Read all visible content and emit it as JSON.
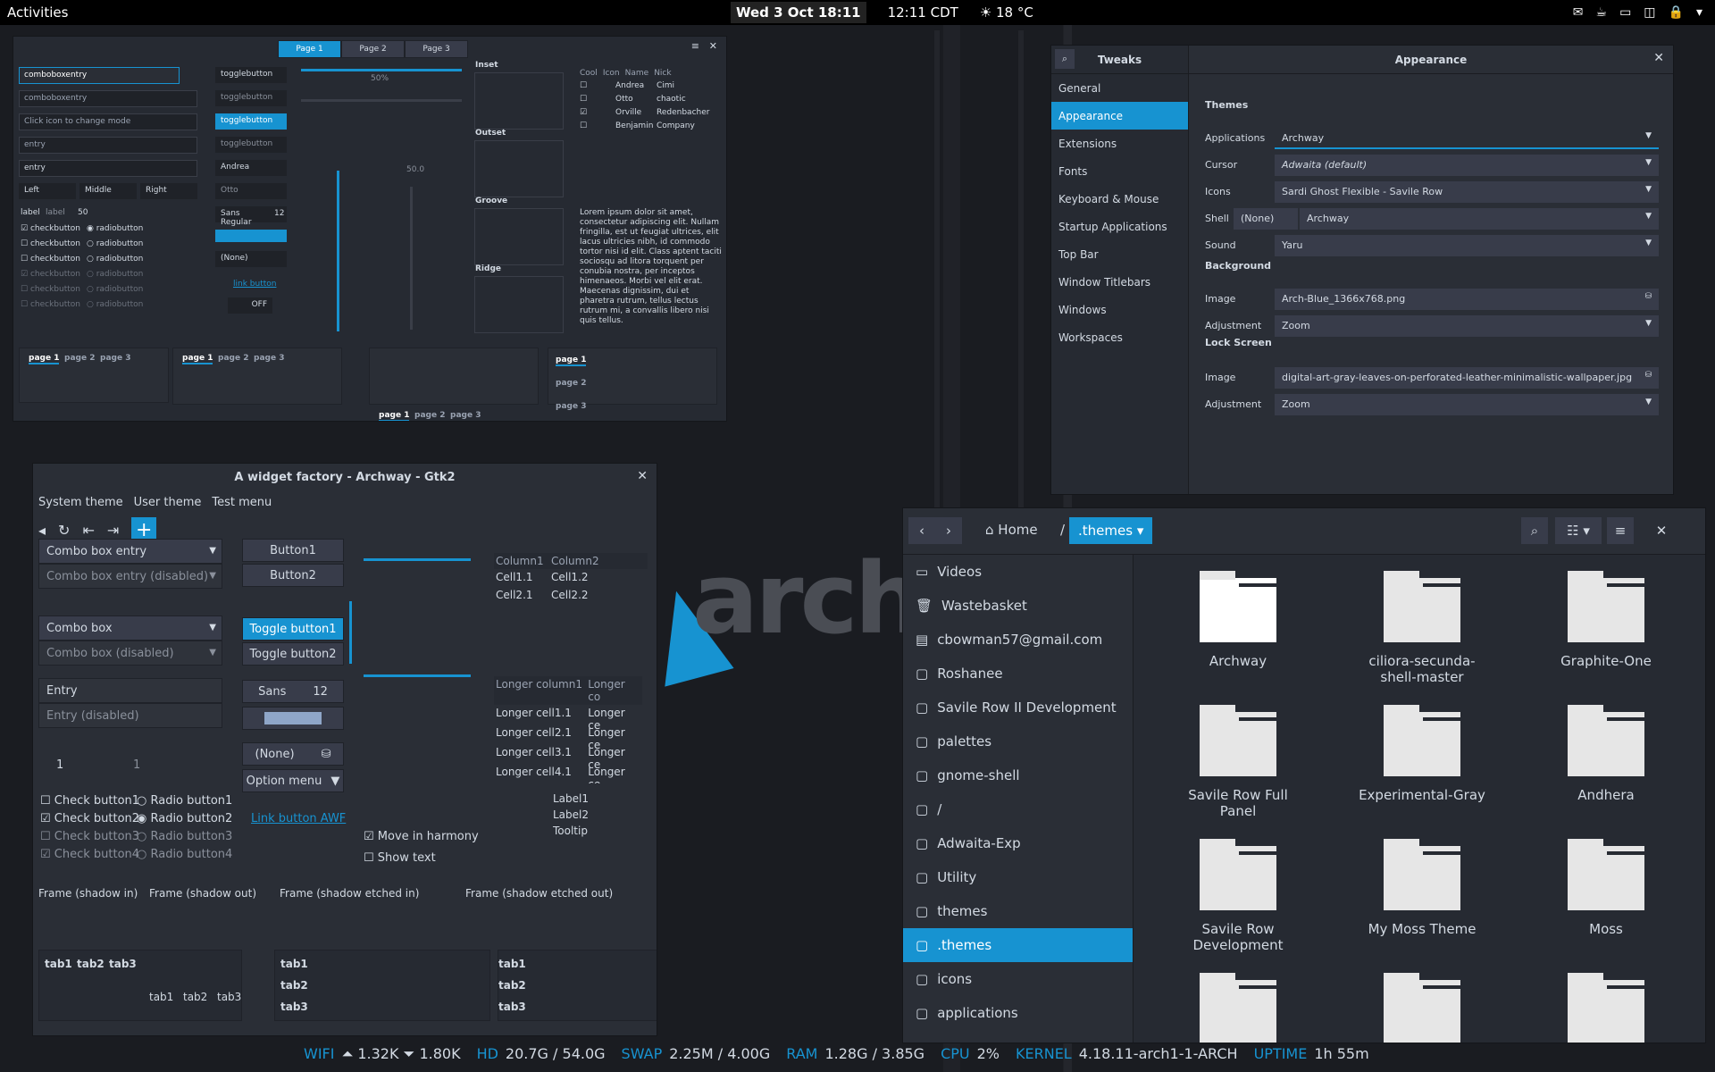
{
  "topbar": {
    "activities": "Activities",
    "clock": "Wed 3 Oct  18:11",
    "cdt": "12:11 CDT",
    "weather": "☀ 18 °C",
    "tray": [
      "✉",
      "☕",
      "▭",
      "◫",
      "🔒",
      "▾"
    ]
  },
  "statusbar": [
    {
      "k": "WIFI",
      "v": "⏶ 1.32K ⏷ 1.80K"
    },
    {
      "k": "HD",
      "v": "20.7G / 54.0G"
    },
    {
      "k": "SWAP",
      "v": "2.25M / 4.00G"
    },
    {
      "k": "RAM",
      "v": "1.28G / 3.85G"
    },
    {
      "k": "CPU",
      "v": "2%"
    },
    {
      "k": "KERNEL",
      "v": "4.18.11-arch1-1-ARCH"
    },
    {
      "k": "UPTIME",
      "v": "1h 55m"
    }
  ],
  "gtk3": {
    "tabs": [
      "Page 1",
      "Page 2",
      "Page 3"
    ],
    "inputs": [
      "comboboxentry",
      "comboboxentry",
      "Click icon to change mode",
      "entry",
      "entry"
    ],
    "align": [
      "Left",
      "Middle",
      "Right"
    ],
    "label": "label",
    "spin": "50",
    "checks": [
      "checkbutton",
      "checkbutton",
      "checkbutton",
      "checkbutton",
      "checkbutton",
      "checkbutton"
    ],
    "radios": [
      "radiobutton",
      "radiobutton",
      "radiobutton",
      "radiobutton",
      "radiobutton",
      "radiobutton"
    ],
    "toggles": [
      "togglebutton",
      "togglebutton",
      "togglebutton",
      "togglebutton"
    ],
    "combo1": "Andrea",
    "combo2": "Otto",
    "font": "Sans Regular",
    "fontsize": "12",
    "none": "(None)",
    "link": "link button",
    "off": "OFF",
    "scale1": "50%",
    "scale2": "50.0",
    "frames": [
      "Inset",
      "Outset",
      "Groove",
      "Ridge"
    ],
    "tree_headers": [
      "Cool",
      "Icon",
      "Name",
      "Nick"
    ],
    "tree": [
      [
        "Andrea",
        "Cimi"
      ],
      [
        "Otto",
        "chaotic"
      ],
      [
        "Orville",
        "Redenbacher"
      ],
      [
        "Benjamin",
        "Company"
      ]
    ],
    "lorem": "Lorem ipsum dolor sit amet, consectetur adipiscing elit. Nullam fringilla, est ut feugiat ultrices, elit lacus ultricies nibh, id commodo tortor nisi id elit. Class aptent taciti sociosqu ad litora torquent per conubia nostra, per inceptos himenaeos. Morbi vel elit erat. Maecenas dignissim, dui et pharetra rutrum, tellus lectus rutrum mi, a convallis libero nisi quis tellus.",
    "nb": [
      "page 1",
      "page 2",
      "page 3"
    ]
  },
  "tweaks": {
    "title": "Tweaks",
    "header": "Appearance",
    "sidebar": [
      "General",
      "Appearance",
      "Extensions",
      "Fonts",
      "Keyboard & Mouse",
      "Startup Applications",
      "Top Bar",
      "Window Titlebars",
      "Windows",
      "Workspaces"
    ],
    "themes": "Themes",
    "background": "Background",
    "lockscreen": "Lock Screen",
    "rows": {
      "applications": [
        "Applications",
        "Archway"
      ],
      "cursor": [
        "Cursor",
        "Adwaita (default)"
      ],
      "icons": [
        "Icons",
        "Sardi Ghost Flexible - Savile Row"
      ],
      "shell": [
        "Shell",
        "(None)",
        "Archway"
      ],
      "sound": [
        "Sound",
        "Yaru"
      ],
      "bgimage": [
        "Image",
        "Arch-Blue_1366x768.png"
      ],
      "bgadj": [
        "Adjustment",
        "Zoom"
      ],
      "lsimage": [
        "Image",
        "digital-art-gray-leaves-on-perforated-leather-minimalistic-wallpaper.jpg"
      ],
      "lsadj": [
        "Adjustment",
        "Zoom"
      ]
    }
  },
  "gtk2": {
    "title": "A widget factory - Archway - Gtk2",
    "menu": [
      "System theme",
      "User theme",
      "Test menu"
    ],
    "combos": [
      "Combo box entry",
      "Combo box entry (disabled)",
      "Combo box",
      "Combo box (disabled)"
    ],
    "entries": [
      "Entry",
      "Entry (disabled)"
    ],
    "spin": [
      "1",
      "1"
    ],
    "checks": [
      "Check button1",
      "Check button2",
      "Check button3",
      "Check button4"
    ],
    "radios": [
      "Radio button1",
      "Radio button2",
      "Radio button3",
      "Radio button4"
    ],
    "buttons": [
      "Button1",
      "Button2",
      "Toggle button1",
      "Toggle button2"
    ],
    "font": [
      "Sans",
      "12"
    ],
    "none": "(None)",
    "option": "Option menu",
    "link": "Link button AWF",
    "move": "Move in harmony",
    "show": "Show text",
    "tree1_headers": [
      "Column1",
      "Column2"
    ],
    "tree1": [
      [
        "Cell1.1",
        "Cell1.2"
      ],
      [
        "Cell2.1",
        "Cell2.2"
      ]
    ],
    "tree2_headers": [
      "Longer column1",
      "Longer co"
    ],
    "tree2": [
      [
        "Longer cell1.1",
        "Longer ce"
      ],
      [
        "Longer cell2.1",
        "Longer ce"
      ],
      [
        "Longer cell3.1",
        "Longer ce"
      ],
      [
        "Longer cell4.1",
        "Longer ce"
      ]
    ],
    "labels": [
      "Label1",
      "Label2",
      "Tooltip"
    ],
    "frames": [
      "Frame (shadow in)",
      "Frame (shadow out)",
      "Frame (shadow etched in)",
      "Frame (shadow etched out)"
    ],
    "tabs": [
      "tab1",
      "tab2",
      "tab3"
    ]
  },
  "files": {
    "path": [
      "Home",
      ".themes"
    ],
    "sidebar": [
      [
        "▭",
        "Videos"
      ],
      [
        "🗑",
        "Wastebasket"
      ],
      [
        "▤",
        "cbowman57@gmail.com"
      ],
      [
        "▢",
        "Roshanee"
      ],
      [
        "▢",
        "Savile Row II Development"
      ],
      [
        "▢",
        "palettes"
      ],
      [
        "▢",
        "gnome-shell"
      ],
      [
        "▢",
        "/"
      ],
      [
        "▢",
        "Adwaita-Exp"
      ],
      [
        "▢",
        "Utility"
      ],
      [
        "▢",
        "themes"
      ],
      [
        "▢",
        ".themes"
      ],
      [
        "▢",
        "icons"
      ],
      [
        "▢",
        "applications"
      ]
    ],
    "folders": [
      "Archway",
      "ciliora-secunda-shell-master",
      "Graphite-One",
      "Savile Row Full Panel",
      "Experimental-Gray",
      "Andhera",
      "Savile Row Development",
      "My Moss Theme",
      "Moss",
      "",
      "",
      ""
    ]
  },
  "wallpaper": {
    "logo": "arch",
    "tm": "™"
  }
}
